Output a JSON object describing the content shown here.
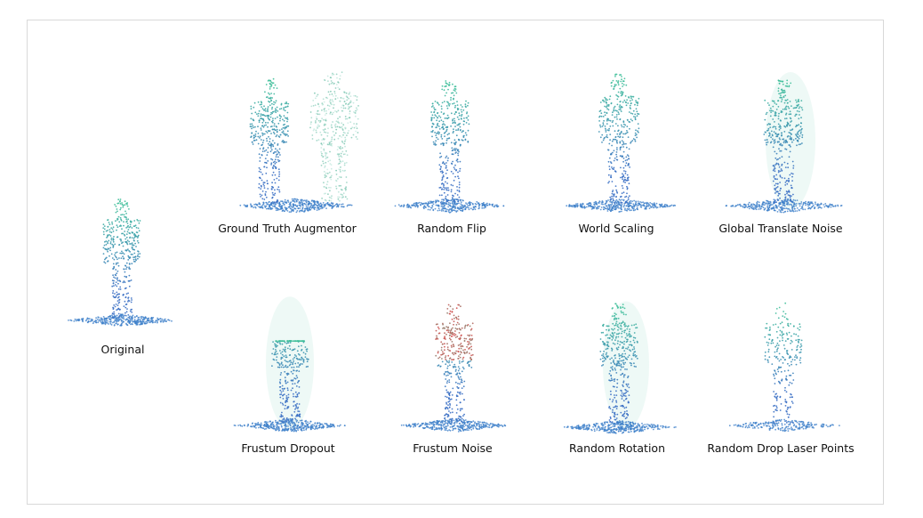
{
  "original": {
    "label": "Original"
  },
  "augmentations": [
    {
      "id": "ground-truth-augmentor",
      "label": "Ground Truth Augmentor"
    },
    {
      "id": "random-flip",
      "label": "Random Flip"
    },
    {
      "id": "world-scaling",
      "label": "World Scaling"
    },
    {
      "id": "global-translate-noise",
      "label": "Global Translate Noise"
    },
    {
      "id": "frustum-dropout",
      "label": "Frustum Dropout"
    },
    {
      "id": "frustum-noise",
      "label": "Frustum Noise"
    },
    {
      "id": "random-rotation",
      "label": "Random Rotation"
    },
    {
      "id": "random-drop-laser-points",
      "label": "Random Drop Laser Points"
    }
  ],
  "colors": {
    "person_top": "#3fbf9a",
    "person_bottom": "#3a6fc4",
    "ground": "#3d7fc9",
    "noise_red": "#d84a4a",
    "ghost": "#cfeee6",
    "frame_border": "#d9d9d9"
  }
}
